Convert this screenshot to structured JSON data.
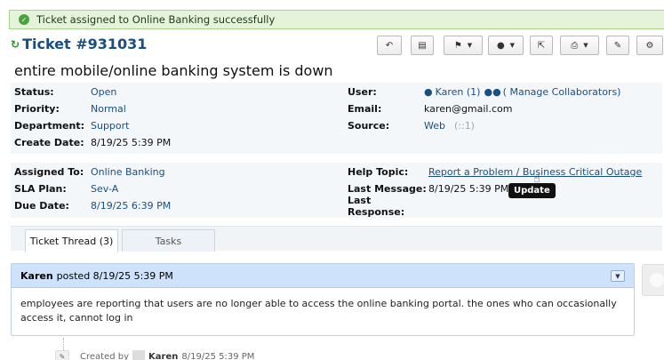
{
  "alert": {
    "message": "Ticket assigned to Online Banking successfully",
    "icon": "check-circle-icon"
  },
  "ticket": {
    "number": "Ticket #931031",
    "subject": "entire mobile/online banking system is down"
  },
  "toolbar": {
    "icons": [
      "reply-icon",
      "print-pdf-icon",
      "flag-icon",
      "user-icon",
      "share-icon",
      "printer-icon",
      "edit-icon",
      "gear-icon"
    ]
  },
  "info": {
    "status_label": "Status:",
    "status": "Open",
    "priority_label": "Priority:",
    "priority": "Normal",
    "department_label": "Department:",
    "department": "Support",
    "create_date_label": "Create Date:",
    "create_date": "8/19/25 5:39 PM",
    "user_label": "User:",
    "user": "Karen (1)",
    "manage_collaborators": "( Manage Collaborators)",
    "email_label": "Email:",
    "email": "karen@gmail.com",
    "source_label": "Source:",
    "source": "Web",
    "source_ip": "(::1)",
    "assigned_to_label": "Assigned To:",
    "assigned_to": "Online Banking",
    "sla_plan_label": "SLA Plan:",
    "sla_plan": "Sev-A",
    "due_date_label": "Due Date:",
    "due_date": "8/19/25 6:39 PM",
    "help_topic_label": "Help Topic:",
    "help_topic": "Report a Problem / Business Critical Outage",
    "last_message_label": "Last Message:",
    "last_message": "8/19/25 5:39 PM",
    "last_response_label": "Last Response:",
    "last_response": ""
  },
  "tooltip": "Update",
  "tabs": [
    {
      "label": "Ticket Thread (3)",
      "active": true
    },
    {
      "label": "Tasks",
      "active": false
    }
  ],
  "thread": {
    "author": "Karen",
    "posted": "posted 8/19/25 5:39 PM",
    "body": "employees are reporting that users are no longer able to access the online banking portal. the ones who can occasionally access it, cannot log in"
  },
  "footer": {
    "created_by": "Created by",
    "author": "Karen",
    "date": "8/19/25 5:39 PM"
  },
  "colors": {
    "link": "#184e82",
    "alert_bg": "#e4f3d9",
    "thread_head": "#cfe2fb"
  }
}
